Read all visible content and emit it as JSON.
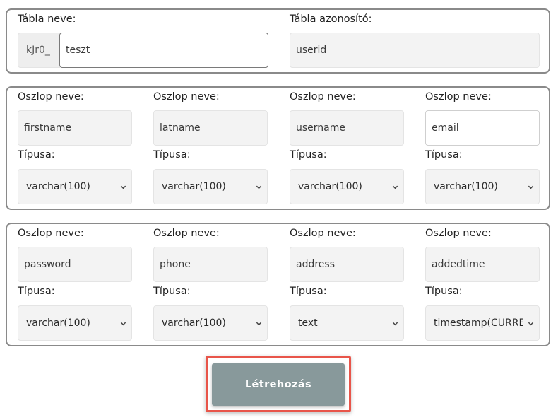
{
  "table_section": {
    "name_label": "Tábla neve:",
    "prefix": "kJr0_",
    "name_value": "teszt",
    "id_label": "Tábla azonosító:",
    "id_value": "userid"
  },
  "column_name_label": "Oszlop neve:",
  "column_type_label": "Típusa:",
  "columns_row1": [
    {
      "name": "firstname",
      "type": "varchar(100)"
    },
    {
      "name": "latname",
      "type": "varchar(100)"
    },
    {
      "name": "username",
      "type": "varchar(100)"
    },
    {
      "name": "email",
      "type": "varchar(100)"
    }
  ],
  "columns_row2": [
    {
      "name": "password",
      "type": "varchar(100)"
    },
    {
      "name": "phone",
      "type": "varchar(100)"
    },
    {
      "name": "address",
      "type": "text"
    },
    {
      "name": "addedtime",
      "type": "timestamp(CURRENT_TIMESTAMP)"
    }
  ],
  "submit_label": "Létrehozás",
  "colors": {
    "submit_bg": "#88999b",
    "highlight_border": "#e8554a",
    "panel_border": "#8a8a8a"
  }
}
